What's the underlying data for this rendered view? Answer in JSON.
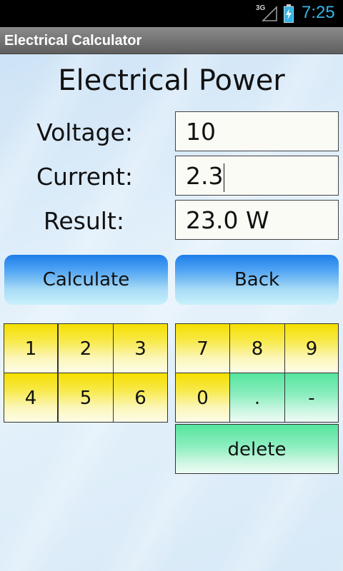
{
  "status_bar": {
    "network": "3G",
    "time": "7:25"
  },
  "app": {
    "title": "Electrical Calculator"
  },
  "page": {
    "title": "Electrical Power"
  },
  "form": {
    "voltage_label": "Voltage:",
    "voltage_value": "10",
    "current_label": "Current:",
    "current_value": "2.3",
    "result_label": "Result:",
    "result_value": "23.0 W"
  },
  "buttons": {
    "calculate": "Calculate",
    "back": "Back"
  },
  "keypad": {
    "left": [
      "1",
      "2",
      "3",
      "4",
      "5",
      "6"
    ],
    "right": [
      "7",
      "8",
      "9",
      "0",
      ".",
      "-"
    ],
    "delete": "delete"
  },
  "colors": {
    "accent": "#33b5e5",
    "button_blue": "#1e7ee8",
    "key_yellow": "#f5df00",
    "key_green": "#55e49d"
  }
}
